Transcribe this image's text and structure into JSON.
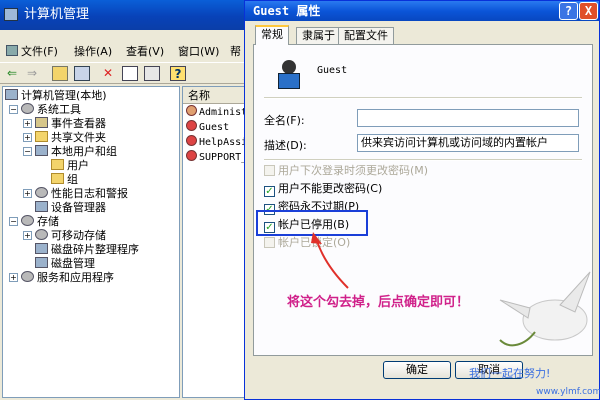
{
  "cm_window": {
    "title": "计算机管理",
    "menu": {
      "file": "文件(F)",
      "action": "操作(A)",
      "view": "查看(V)",
      "window": "窗口(W)",
      "help": "帮"
    },
    "tree": {
      "root": "计算机管理(本地)",
      "system_tools": "系统工具",
      "event_viewer": "事件查看器",
      "shared_folders": "共享文件夹",
      "local_users_groups": "本地用户和组",
      "users": "用户",
      "groups": "组",
      "perf_logs": "性能日志和警报",
      "device_manager": "设备管理器",
      "storage": "存储",
      "removable_storage": "可移动存储",
      "defrag": "磁盘碎片整理程序",
      "disk_mgmt": "磁盘管理",
      "services_apps": "服务和应用程序"
    },
    "list": {
      "header": "名称",
      "items": [
        "Administ",
        "Guest",
        "HelpAssi",
        "SUPPORT_"
      ]
    }
  },
  "dialog": {
    "title": "Guest 属性",
    "help_glyph": "?",
    "close_glyph": "X",
    "tabs": [
      "常规",
      "隶属于",
      "配置文件"
    ],
    "user_name": "Guest",
    "fullname_label": "全名(F):",
    "fullname_value": "",
    "desc_label": "描述(D):",
    "desc_value": "供来宾访问计算机或访问域的内置帐户",
    "options": [
      {
        "label": "用户下次登录时须更改密码(M)",
        "checked": false,
        "enabled": false
      },
      {
        "label": "用户不能更改密码(C)",
        "checked": true,
        "enabled": true
      },
      {
        "label": "密码永不过期(P)",
        "checked": true,
        "enabled": true
      },
      {
        "label": "帐户已停用(B)",
        "checked": true,
        "enabled": true
      },
      {
        "label": "帐户已锁定(O)",
        "checked": false,
        "enabled": false
      }
    ],
    "ok_label": "确定",
    "cancel_label": "取消"
  },
  "annotation": "将这个勾去掉，后点确定即可！",
  "watermark": {
    "line1": "我们一起在努力!",
    "line2": "www.ylmf.com"
  },
  "colors": {
    "title_bar": "#0842b8",
    "highlight_box": "#1a3fd8",
    "annotation": "#d0218a",
    "arrow": "#e0302a"
  }
}
